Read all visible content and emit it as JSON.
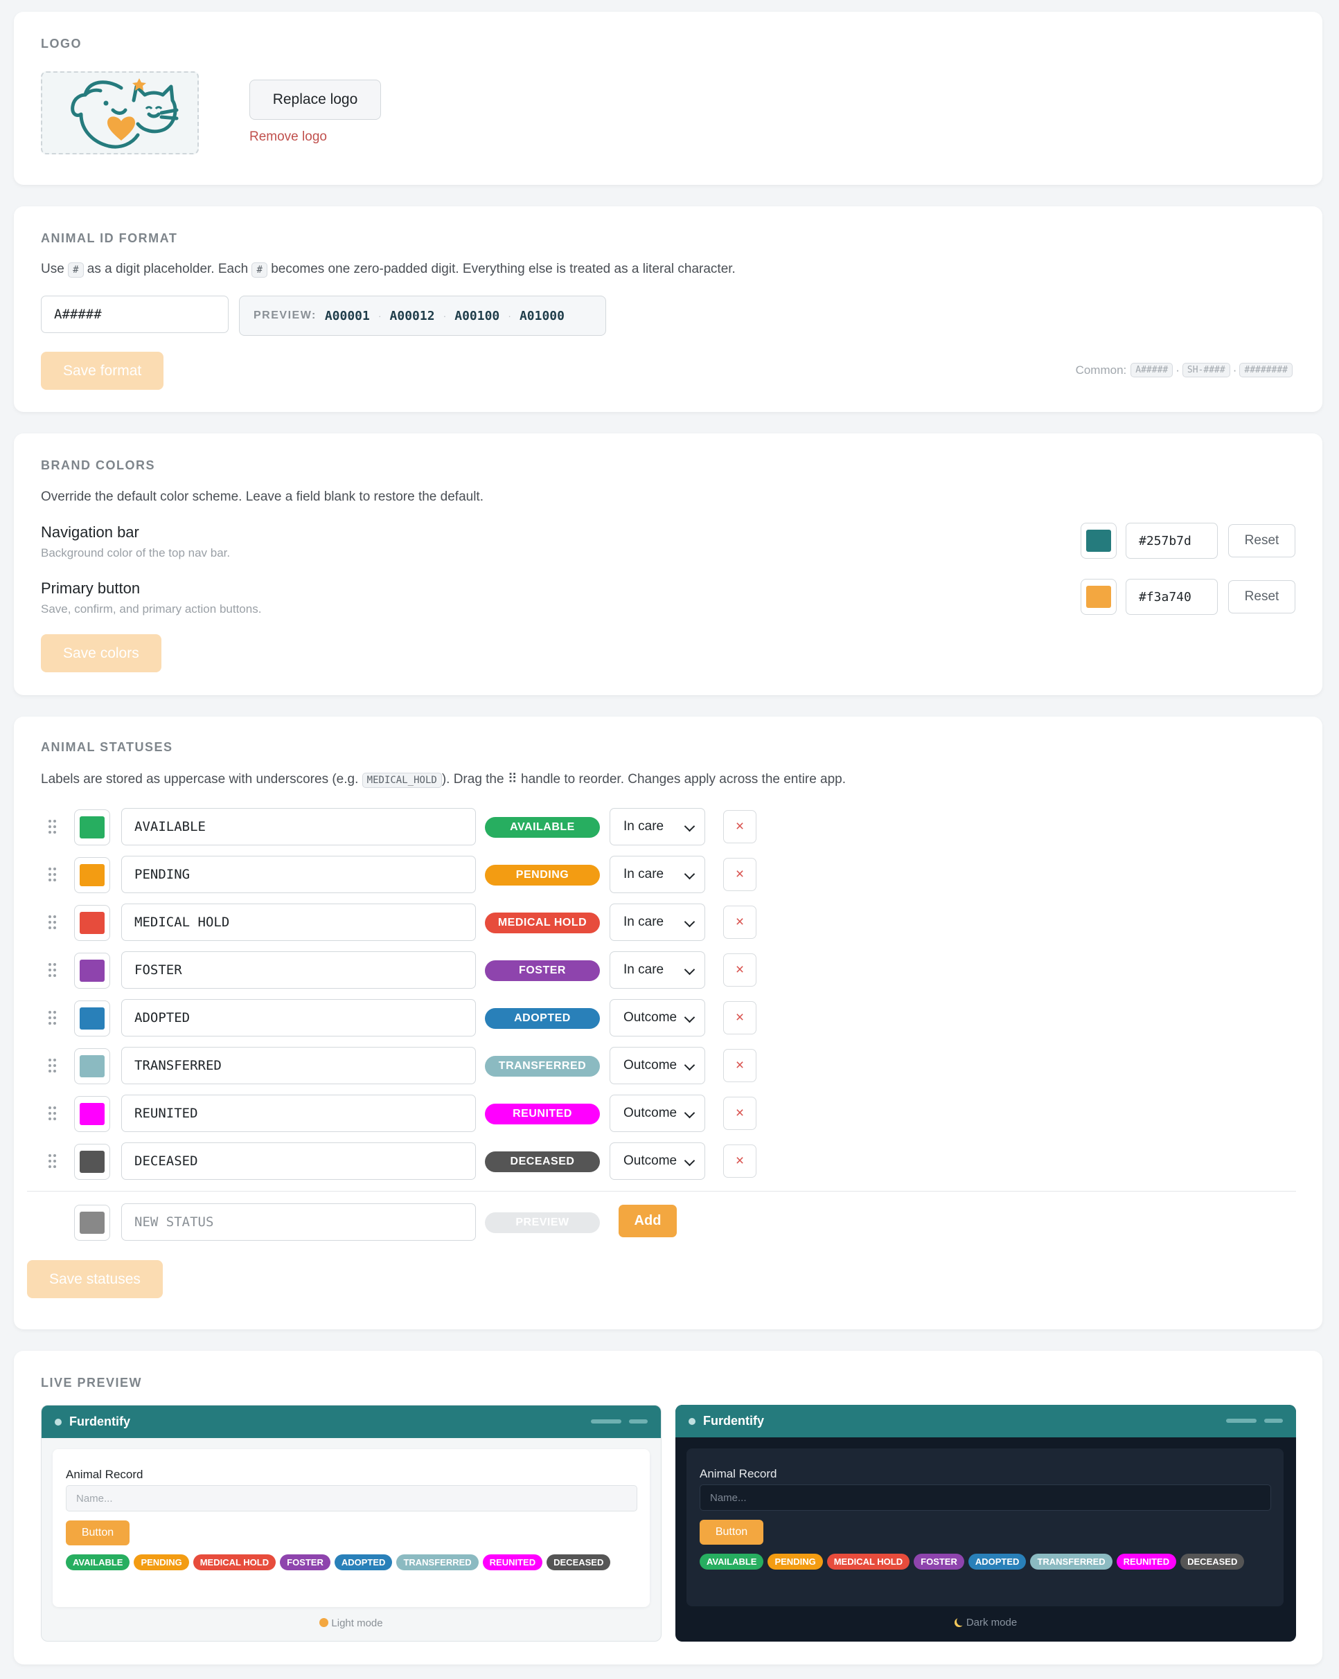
{
  "logo_section": {
    "title": "LOGO",
    "replace_label": "Replace logo",
    "remove_label": "Remove logo",
    "logo_icon": "pet-heart-logo"
  },
  "id_format": {
    "title": "ANIMAL ID FORMAT",
    "desc_pre": "Use",
    "desc_code1": "#",
    "desc_mid": "as a digit placeholder. Each",
    "desc_code2": "#",
    "desc_post": "becomes one zero-padded digit. Everything else is treated as a literal character.",
    "value": "A#####",
    "preview_label": "PREVIEW:",
    "previews": [
      "A00001",
      "A00012",
      "A00100",
      "A01000"
    ],
    "save_label": "Save format",
    "common_label": "Common:",
    "common": [
      "A#####",
      "SH-####",
      "########"
    ]
  },
  "brand": {
    "title": "BRAND COLORS",
    "desc": "Override the default color scheme. Leave a field blank to restore the default.",
    "rows": [
      {
        "title": "Navigation bar",
        "sub": "Background color of the top nav bar.",
        "color": "#257b7d",
        "hex": "#257b7d",
        "reset": "Reset"
      },
      {
        "title": "Primary button",
        "sub": "Save, confirm, and primary action buttons.",
        "color": "#f3a740",
        "hex": "#f3a740",
        "reset": "Reset"
      }
    ],
    "save_label": "Save colors"
  },
  "statuses": {
    "title": "ANIMAL STATUSES",
    "desc_pre": "Labels are stored as uppercase with underscores (e.g.",
    "desc_code": "MEDICAL_HOLD",
    "desc_post": "). Drag the ⠿ handle to reorder. Changes apply across the entire app.",
    "items": [
      {
        "label": "AVAILABLE",
        "pill": "AVAILABLE",
        "color": "#27ae60",
        "category": "In care"
      },
      {
        "label": "PENDING",
        "pill": "PENDING",
        "color": "#f39c12",
        "category": "In care"
      },
      {
        "label": "MEDICAL HOLD",
        "pill": "MEDICAL HOLD",
        "color": "#e74c3c",
        "category": "In care"
      },
      {
        "label": "FOSTER",
        "pill": "FOSTER",
        "color": "#8e44ad",
        "category": "In care"
      },
      {
        "label": "ADOPTED",
        "pill": "ADOPTED",
        "color": "#2980b9",
        "category": "Outcome"
      },
      {
        "label": "TRANSFERRED",
        "pill": "TRANSFERRED",
        "color": "#8bbac1",
        "category": "Outcome"
      },
      {
        "label": "REUNITED",
        "pill": "REUNITED",
        "color": "#ff00ff",
        "category": "Outcome"
      },
      {
        "label": "DECEASED",
        "pill": "DECEASED",
        "color": "#555555",
        "category": "Outcome"
      }
    ],
    "delete_label": "×",
    "new_placeholder": "NEW STATUS",
    "new_color": "#888888",
    "new_preview": "PREVIEW",
    "add_label": "Add",
    "save_label": "Save statuses"
  },
  "live_preview": {
    "title": "LIVE PREVIEW",
    "app_name": "Furdentify",
    "card_title": "Animal Record",
    "name_placeholder": "Name...",
    "button_label": "Button",
    "light_label": "Light mode",
    "dark_label": "Dark mode",
    "light_icon": "sun-icon",
    "dark_icon": "moon-icon"
  }
}
